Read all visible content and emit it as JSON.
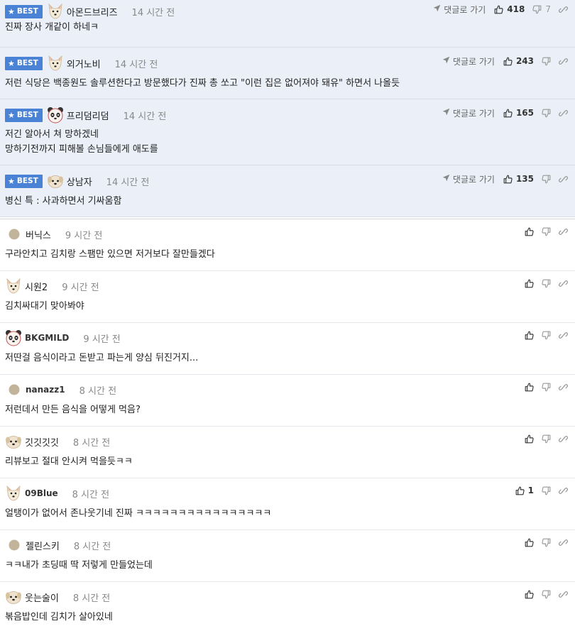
{
  "labels": {
    "best": "BEST",
    "reply": "댓글로 가기"
  },
  "colors": {
    "best_bg": "#ebf0f8",
    "badge": "#4a82d6"
  },
  "best_comments": [
    {
      "nick": "아몬드브리즈",
      "avatar": "dog-white-avatar",
      "time": "14 시간 전",
      "lines": [
        "진짜 장사 개같이 하네ㅋ"
      ],
      "likes": "418",
      "dislikes": "7"
    },
    {
      "nick": "외거노비",
      "avatar": "dog-white-avatar",
      "time": "14 시간 전",
      "lines": [
        "저런 식당은 백종원도 솔루션한다고 방문했다가 진짜 총 쏘고 \"이런 집은 없어져야 돼유\" 하면서 나올듯"
      ],
      "likes": "243",
      "dislikes": ""
    },
    {
      "nick": "프리덤리덤",
      "avatar": "panda-avatar",
      "time": "14 시간 전",
      "lines": [
        "저긴 알아서 쳐 망하겠네",
        "망하기전까지 피해볼 손님들에게 애도를"
      ],
      "likes": "165",
      "dislikes": ""
    },
    {
      "nick": "상남자",
      "avatar": "puppy-avatar",
      "time": "14 시간 전",
      "lines": [
        "병신 특 : 사과하면서 기싸움함"
      ],
      "likes": "135",
      "dislikes": ""
    }
  ],
  "comments": [
    {
      "nick": "버닉스",
      "avatar": "default-avatar",
      "time": "9 시간 전",
      "text": "구라안치고 김치랑 스팸만 있으면 저거보다 잘만들겠다",
      "likes": ""
    },
    {
      "nick": "시원2",
      "avatar": "dog-white-avatar",
      "time": "9 시간 전",
      "text": "김치싸대기 맞아봐야",
      "likes": ""
    },
    {
      "nick": "BKGMILD",
      "avatar": "panda-avatar",
      "time": "9 시간 전",
      "text": "저딴걸 음식이라고 돈받고 파는게 양심 뒤진거지...",
      "likes": ""
    },
    {
      "nick": "nanazz1",
      "avatar": "default-avatar",
      "time": "8 시간 전",
      "text": "저런데서 만든 음식을 어떻게 먹음?",
      "likes": ""
    },
    {
      "nick": "깃깃깃깃",
      "avatar": "puppy-avatar",
      "time": "8 시간 전",
      "text": "리뷰보고 절대 안시켜 먹을듯ㅋㅋ",
      "likes": ""
    },
    {
      "nick": "09Blue",
      "avatar": "dog-white-avatar",
      "time": "8 시간 전",
      "text": "얼탱이가 없어서 존나웃기네 진짜 ㅋㅋㅋㅋㅋㅋㅋㅋㅋㅋㅋㅋㅋㅋㅋㅋ",
      "likes": "1"
    },
    {
      "nick": "젤린스키",
      "avatar": "default-avatar",
      "time": "8 시간 전",
      "text": "ㅋㅋ내가 초딩때 딱 저렇게 만들었는데",
      "likes": ""
    },
    {
      "nick": "웃는술이",
      "avatar": "puppy-avatar",
      "time": "8 시간 전",
      "text": "볶음밥인데 김치가 살아있네",
      "likes": ""
    }
  ]
}
